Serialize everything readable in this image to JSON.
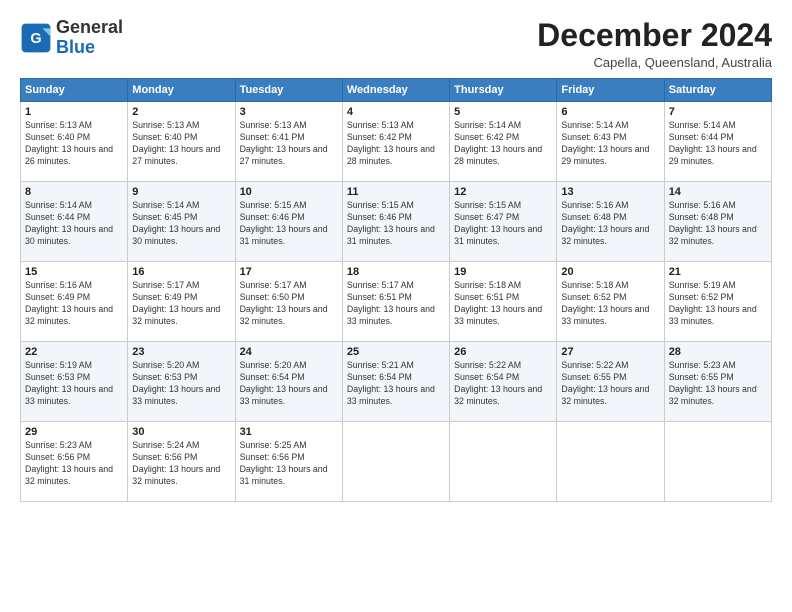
{
  "logo": {
    "name_part1": "General",
    "name_part2": "Blue"
  },
  "header": {
    "month": "December 2024",
    "location": "Capella, Queensland, Australia"
  },
  "weekdays": [
    "Sunday",
    "Monday",
    "Tuesday",
    "Wednesday",
    "Thursday",
    "Friday",
    "Saturday"
  ],
  "weeks": [
    [
      {
        "day": "1",
        "sunrise": "5:13 AM",
        "sunset": "6:40 PM",
        "daylight": "13 hours and 26 minutes."
      },
      {
        "day": "2",
        "sunrise": "5:13 AM",
        "sunset": "6:40 PM",
        "daylight": "13 hours and 27 minutes."
      },
      {
        "day": "3",
        "sunrise": "5:13 AM",
        "sunset": "6:41 PM",
        "daylight": "13 hours and 27 minutes."
      },
      {
        "day": "4",
        "sunrise": "5:13 AM",
        "sunset": "6:42 PM",
        "daylight": "13 hours and 28 minutes."
      },
      {
        "day": "5",
        "sunrise": "5:14 AM",
        "sunset": "6:42 PM",
        "daylight": "13 hours and 28 minutes."
      },
      {
        "day": "6",
        "sunrise": "5:14 AM",
        "sunset": "6:43 PM",
        "daylight": "13 hours and 29 minutes."
      },
      {
        "day": "7",
        "sunrise": "5:14 AM",
        "sunset": "6:44 PM",
        "daylight": "13 hours and 29 minutes."
      }
    ],
    [
      {
        "day": "8",
        "sunrise": "5:14 AM",
        "sunset": "6:44 PM",
        "daylight": "13 hours and 30 minutes."
      },
      {
        "day": "9",
        "sunrise": "5:14 AM",
        "sunset": "6:45 PM",
        "daylight": "13 hours and 30 minutes."
      },
      {
        "day": "10",
        "sunrise": "5:15 AM",
        "sunset": "6:46 PM",
        "daylight": "13 hours and 31 minutes."
      },
      {
        "day": "11",
        "sunrise": "5:15 AM",
        "sunset": "6:46 PM",
        "daylight": "13 hours and 31 minutes."
      },
      {
        "day": "12",
        "sunrise": "5:15 AM",
        "sunset": "6:47 PM",
        "daylight": "13 hours and 31 minutes."
      },
      {
        "day": "13",
        "sunrise": "5:16 AM",
        "sunset": "6:48 PM",
        "daylight": "13 hours and 32 minutes."
      },
      {
        "day": "14",
        "sunrise": "5:16 AM",
        "sunset": "6:48 PM",
        "daylight": "13 hours and 32 minutes."
      }
    ],
    [
      {
        "day": "15",
        "sunrise": "5:16 AM",
        "sunset": "6:49 PM",
        "daylight": "13 hours and 32 minutes."
      },
      {
        "day": "16",
        "sunrise": "5:17 AM",
        "sunset": "6:49 PM",
        "daylight": "13 hours and 32 minutes."
      },
      {
        "day": "17",
        "sunrise": "5:17 AM",
        "sunset": "6:50 PM",
        "daylight": "13 hours and 32 minutes."
      },
      {
        "day": "18",
        "sunrise": "5:17 AM",
        "sunset": "6:51 PM",
        "daylight": "13 hours and 33 minutes."
      },
      {
        "day": "19",
        "sunrise": "5:18 AM",
        "sunset": "6:51 PM",
        "daylight": "13 hours and 33 minutes."
      },
      {
        "day": "20",
        "sunrise": "5:18 AM",
        "sunset": "6:52 PM",
        "daylight": "13 hours and 33 minutes."
      },
      {
        "day": "21",
        "sunrise": "5:19 AM",
        "sunset": "6:52 PM",
        "daylight": "13 hours and 33 minutes."
      }
    ],
    [
      {
        "day": "22",
        "sunrise": "5:19 AM",
        "sunset": "6:53 PM",
        "daylight": "13 hours and 33 minutes."
      },
      {
        "day": "23",
        "sunrise": "5:20 AM",
        "sunset": "6:53 PM",
        "daylight": "13 hours and 33 minutes."
      },
      {
        "day": "24",
        "sunrise": "5:20 AM",
        "sunset": "6:54 PM",
        "daylight": "13 hours and 33 minutes."
      },
      {
        "day": "25",
        "sunrise": "5:21 AM",
        "sunset": "6:54 PM",
        "daylight": "13 hours and 33 minutes."
      },
      {
        "day": "26",
        "sunrise": "5:22 AM",
        "sunset": "6:54 PM",
        "daylight": "13 hours and 32 minutes."
      },
      {
        "day": "27",
        "sunrise": "5:22 AM",
        "sunset": "6:55 PM",
        "daylight": "13 hours and 32 minutes."
      },
      {
        "day": "28",
        "sunrise": "5:23 AM",
        "sunset": "6:55 PM",
        "daylight": "13 hours and 32 minutes."
      }
    ],
    [
      {
        "day": "29",
        "sunrise": "5:23 AM",
        "sunset": "6:56 PM",
        "daylight": "13 hours and 32 minutes."
      },
      {
        "day": "30",
        "sunrise": "5:24 AM",
        "sunset": "6:56 PM",
        "daylight": "13 hours and 32 minutes."
      },
      {
        "day": "31",
        "sunrise": "5:25 AM",
        "sunset": "6:56 PM",
        "daylight": "13 hours and 31 minutes."
      },
      null,
      null,
      null,
      null
    ]
  ],
  "labels": {
    "sunrise": "Sunrise: ",
    "sunset": "Sunset: ",
    "daylight": "Daylight: "
  }
}
